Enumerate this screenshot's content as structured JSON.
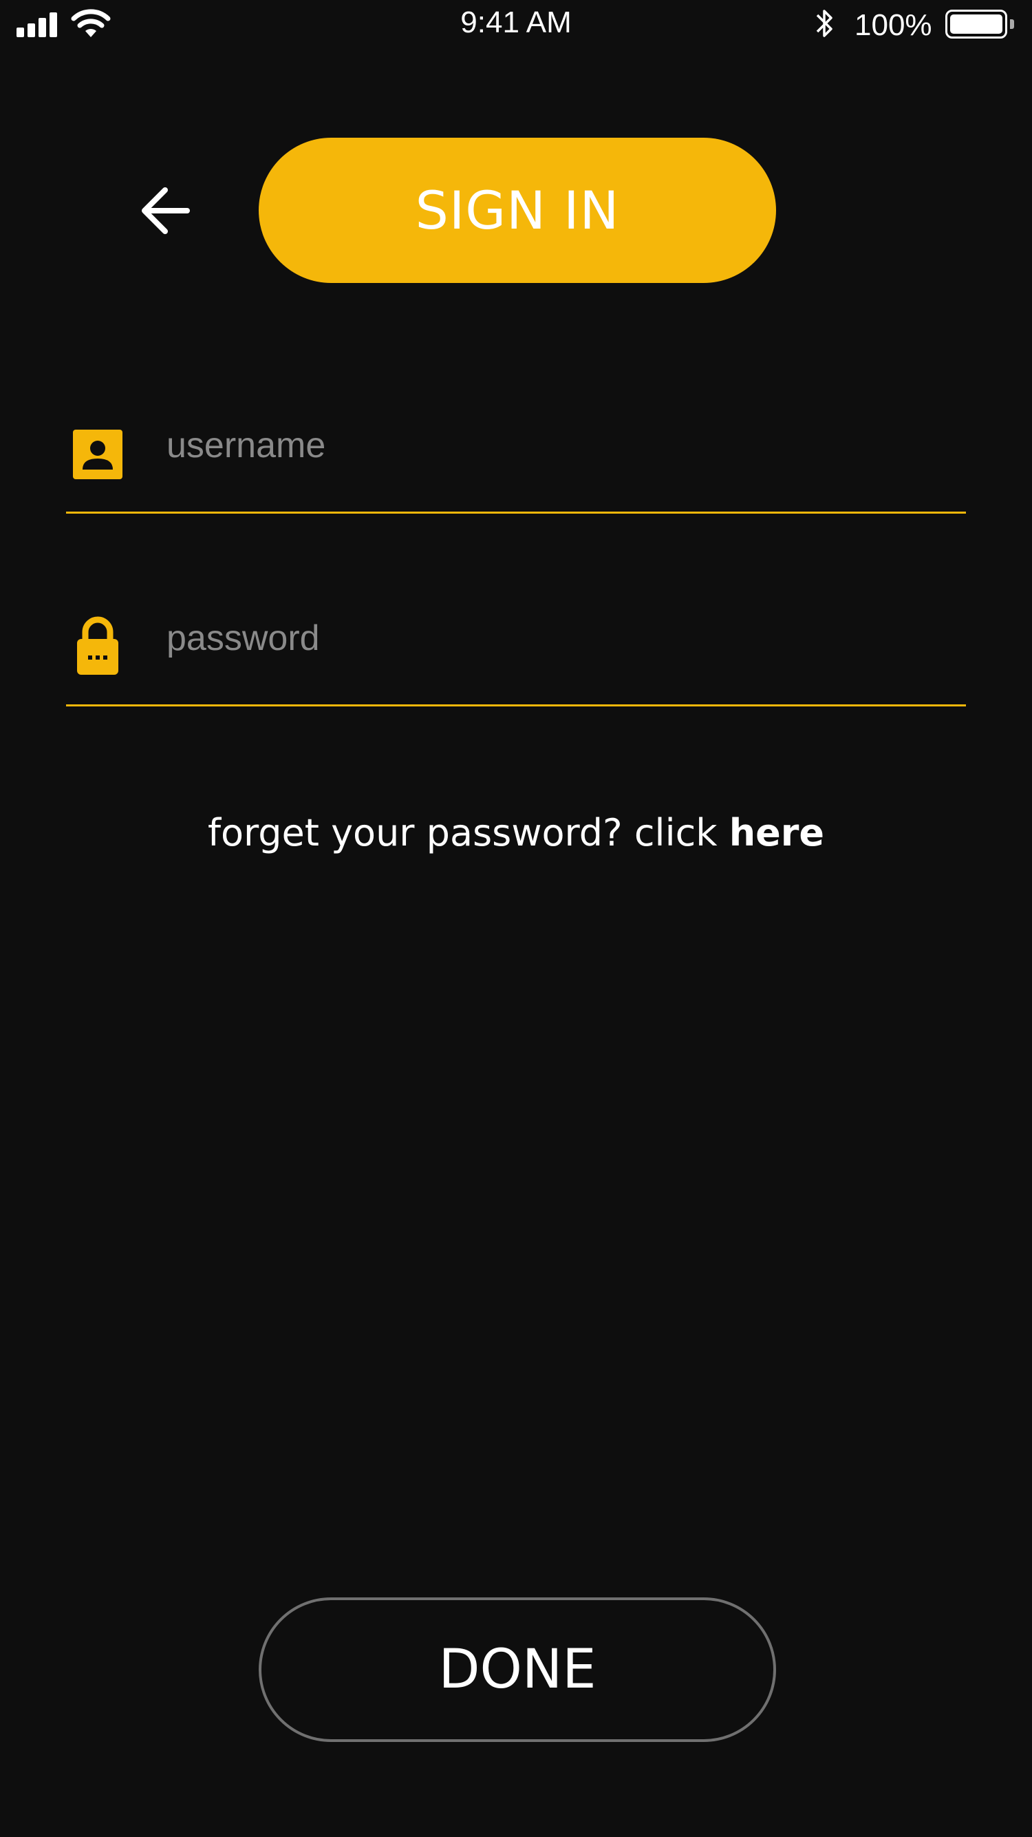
{
  "status_bar": {
    "time": "9:41 AM",
    "battery_percent": "100%",
    "icons": [
      "signal-icon",
      "wifi-icon",
      "bluetooth-icon",
      "battery-icon"
    ]
  },
  "header": {
    "title": "SIGN IN",
    "back_icon": "arrow-left-icon"
  },
  "form": {
    "username": {
      "placeholder": "username",
      "value": "",
      "icon": "user-icon"
    },
    "password": {
      "placeholder": "password",
      "value": "",
      "icon": "lock-icon"
    }
  },
  "forgot": {
    "prefix": "forget your password? click ",
    "link": "here"
  },
  "done_label": "DONE",
  "colors": {
    "background": "#0e0e0e",
    "accent": "#f5b70a",
    "text": "#ffffff",
    "placeholder": "#8a8a8a",
    "outline": "#707070"
  }
}
